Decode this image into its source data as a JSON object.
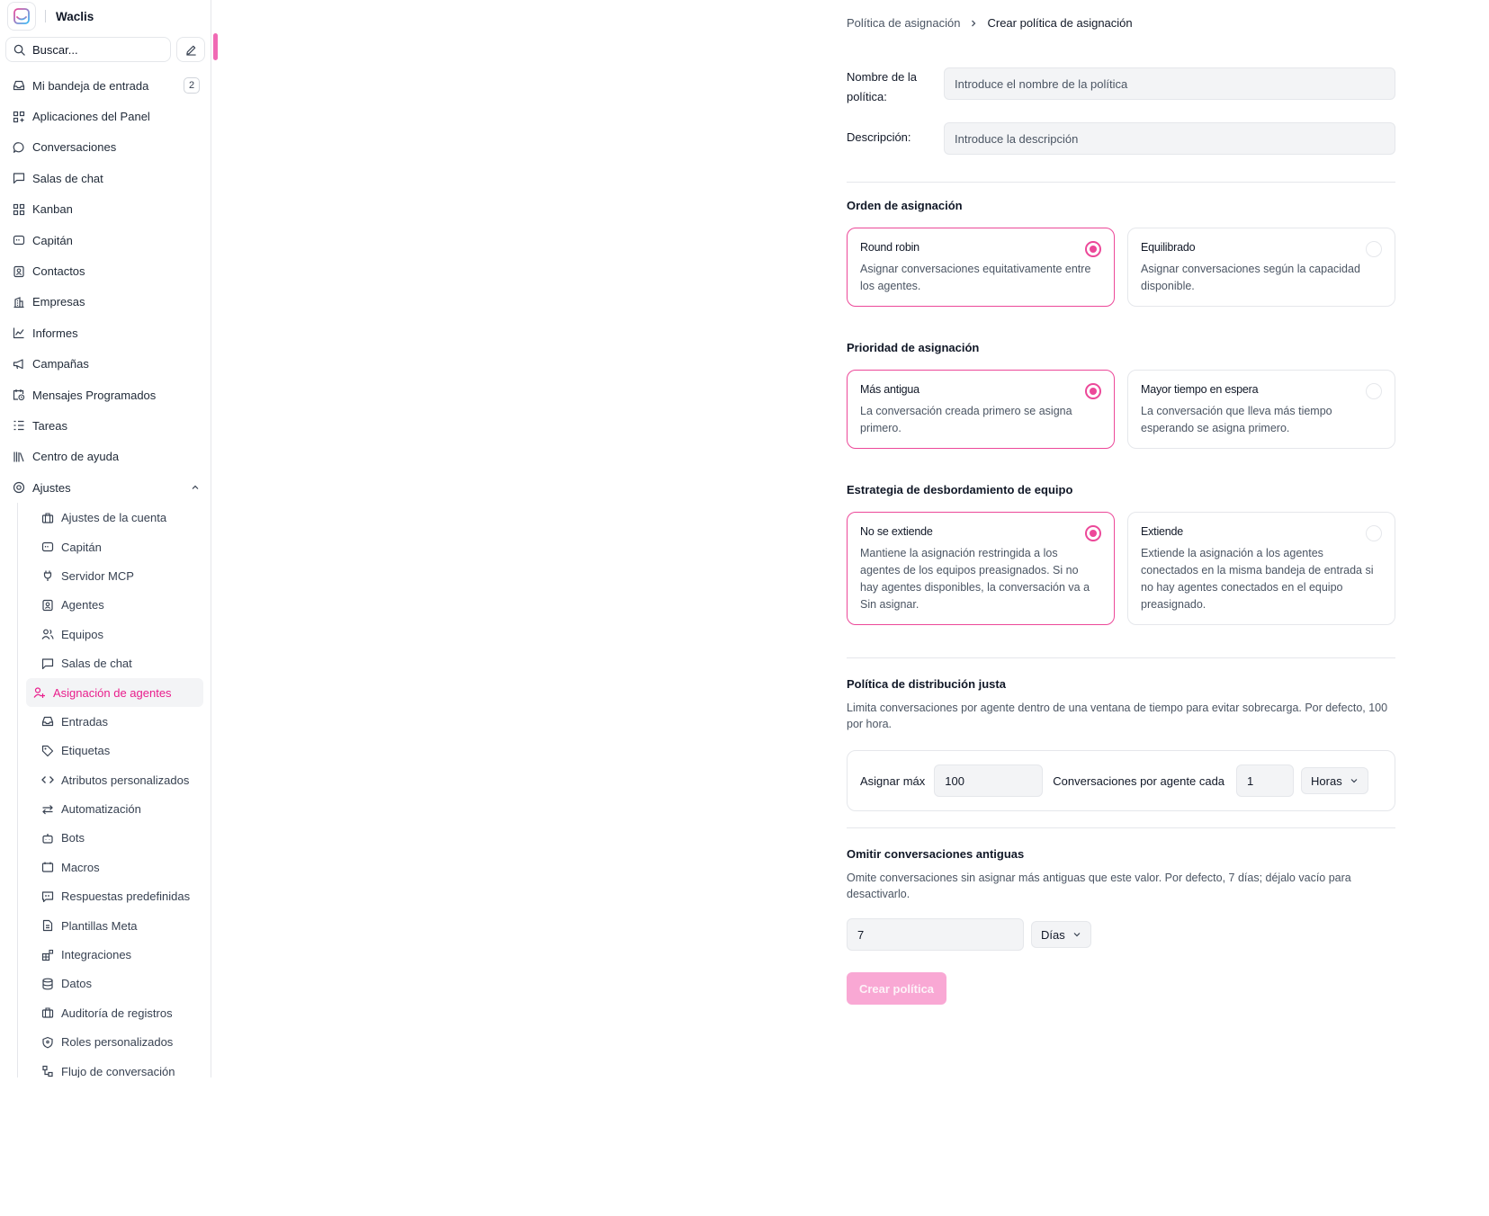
{
  "app": {
    "name": "Waclis"
  },
  "search": {
    "placeholder": "Buscar..."
  },
  "nav": {
    "items": [
      {
        "label": "Mi bandeja de entrada",
        "icon": "inbox-icon",
        "badge": "2"
      },
      {
        "label": "Aplicaciones del Panel",
        "icon": "apps-icon"
      },
      {
        "label": "Conversaciones",
        "icon": "chat-bubble-icon"
      },
      {
        "label": "Salas de chat",
        "icon": "chat-square-icon"
      },
      {
        "label": "Kanban",
        "icon": "kanban-icon"
      },
      {
        "label": "Capitán",
        "icon": "captain-icon"
      },
      {
        "label": "Contactos",
        "icon": "contact-icon"
      },
      {
        "label": "Empresas",
        "icon": "building-icon"
      },
      {
        "label": "Informes",
        "icon": "chart-line-icon"
      },
      {
        "label": "Campañas",
        "icon": "megaphone-icon"
      },
      {
        "label": "Mensajes Programados",
        "icon": "calendar-clock-icon"
      },
      {
        "label": "Tareas",
        "icon": "tasks-icon"
      },
      {
        "label": "Centro de ayuda",
        "icon": "library-icon"
      },
      {
        "label": "Ajustes",
        "icon": "settings-icon",
        "expanded": true
      }
    ],
    "settings_items": [
      {
        "label": "Ajustes de la cuenta",
        "icon": "briefcase-icon"
      },
      {
        "label": "Capitán",
        "icon": "captain-icon"
      },
      {
        "label": "Servidor MCP",
        "icon": "plug-icon"
      },
      {
        "label": "Agentes",
        "icon": "agent-icon"
      },
      {
        "label": "Equipos",
        "icon": "team-icon"
      },
      {
        "label": "Salas de chat",
        "icon": "chat-square-icon"
      },
      {
        "label": "Asignación de agentes",
        "icon": "agent-assign-icon",
        "active": true
      },
      {
        "label": "Entradas",
        "icon": "inbox-icon"
      },
      {
        "label": "Etiquetas",
        "icon": "tag-icon"
      },
      {
        "label": "Atributos personalizados",
        "icon": "code-icon"
      },
      {
        "label": "Automatización",
        "icon": "arrows-icon"
      },
      {
        "label": "Bots",
        "icon": "bot-icon"
      },
      {
        "label": "Macros",
        "icon": "macro-icon"
      },
      {
        "label": "Respuestas predefinidas",
        "icon": "quote-icon"
      },
      {
        "label": "Plantillas Meta",
        "icon": "document-icon"
      },
      {
        "label": "Integraciones",
        "icon": "integrations-icon"
      },
      {
        "label": "Datos",
        "icon": "database-icon"
      },
      {
        "label": "Auditoría de registros",
        "icon": "audit-icon"
      },
      {
        "label": "Roles personalizados",
        "icon": "shield-icon"
      },
      {
        "label": "Flujo de conversación",
        "icon": "flow-icon"
      }
    ]
  },
  "breadcrumb": {
    "parent": "Política de asignación",
    "current": "Crear política de asignación"
  },
  "form": {
    "name_label": "Nombre de la política:",
    "name_placeholder": "Introduce el nombre de la política",
    "description_label": "Descripción:",
    "description_placeholder": "Introduce la descripción"
  },
  "assignment_order": {
    "title": "Orden de asignación",
    "options": [
      {
        "title": "Round robin",
        "description": "Asignar conversaciones equitativamente entre los agentes.",
        "selected": true
      },
      {
        "title": "Equilibrado",
        "description": "Asignar conversaciones según la capacidad disponible.",
        "selected": false
      }
    ]
  },
  "assignment_priority": {
    "title": "Prioridad de asignación",
    "options": [
      {
        "title": "Más antigua",
        "description": "La conversación creada primero se asigna primero.",
        "selected": true
      },
      {
        "title": "Mayor tiempo en espera",
        "description": "La conversación que lleva más tiempo esperando se asigna primero.",
        "selected": false
      }
    ]
  },
  "overflow": {
    "title": "Estrategia de desbordamiento de equipo",
    "options": [
      {
        "title": "No se extiende",
        "description": "Mantiene la asignación restringida a los agentes de los equipos preasignados. Si no hay agentes disponibles, la conversación va a Sin asignar.",
        "selected": true
      },
      {
        "title": "Extiende",
        "description": "Extiende la asignación a los agentes conectados en la misma bandeja de entrada si no hay agentes conectados en el equipo preasignado.",
        "selected": false
      }
    ]
  },
  "fair_distribution": {
    "title": "Política de distribución justa",
    "description": "Limita conversaciones por agente dentro de una ventana de tiempo para evitar sobrecarga. Por defecto, 100 por hora.",
    "max_label": "Asignar máx",
    "max_value": "100",
    "per_label": "Conversaciones por agente cada",
    "window_value": "1",
    "unit": "Horas"
  },
  "skip_old": {
    "title": "Omitir conversaciones antiguas",
    "description": "Omite conversaciones sin asignar más antiguas que este valor. Por defecto, 7 días; déjalo vacío para desactivarlo.",
    "value": "7",
    "unit": "Días"
  },
  "submit": {
    "label": "Crear política"
  },
  "colors": {
    "accent": "#ec4899",
    "active_text": "#e91e8c",
    "button_disabled": "#f9a8d4"
  }
}
